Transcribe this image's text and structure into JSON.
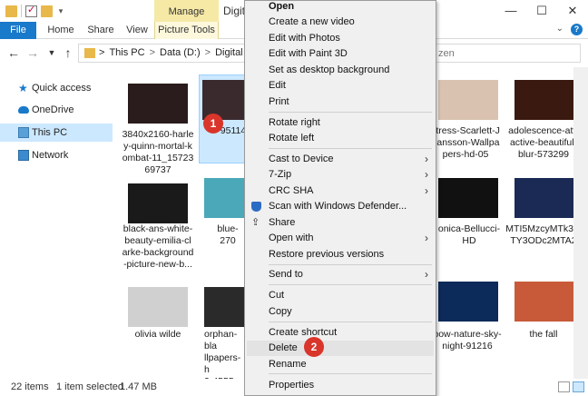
{
  "window": {
    "title": "Digit",
    "manage_tab": "Manage",
    "controls": {
      "minimize": "—",
      "maximize": "☐",
      "close": "✕"
    }
  },
  "ribbon": {
    "tabs": {
      "file": "File",
      "home": "Home",
      "share": "Share",
      "view": "View",
      "picture_tools": "Picture Tools"
    },
    "expand": "⌄",
    "help": "?"
  },
  "address_bar": {
    "crumbs": [
      "This PC",
      "Data (D:)",
      "Digital Citize"
    ],
    "separator": ">",
    "search_value": "zen"
  },
  "sidebar": {
    "items": [
      {
        "label": "Quick access",
        "icon": "star-icon"
      },
      {
        "label": "OneDrive",
        "icon": "cloud-icon"
      },
      {
        "label": "This PC",
        "icon": "computer-icon"
      },
      {
        "label": "Network",
        "icon": "network-icon"
      }
    ]
  },
  "files": [
    {
      "caption": [
        "3840x2160-harle",
        "y-quinn-mortal-k",
        "ombat-11_15723",
        "69737"
      ],
      "color": "#2a1c1c"
    },
    {
      "caption": [
        "95114"
      ],
      "color": "#3a2a2e"
    },
    {
      "caption": [
        "ctress-Scarlett-J",
        "hansson-Wallpa",
        "pers-hd-05"
      ],
      "color": "#d9c3b0"
    },
    {
      "caption": [
        "adolescence-attr",
        "active-beautiful-",
        "blur-573299"
      ],
      "color": "#3a1a10"
    },
    {
      "caption": [
        "black-ans-white-",
        "beauty-emilia-cl",
        "arke-background",
        "-picture-new-b..."
      ],
      "color": "#1a1a1a"
    },
    {
      "caption": [
        "blue-270"
      ],
      "color": "#4aa8b8"
    },
    {
      "caption": [
        "onica-Bellucci-",
        "HD"
      ],
      "color": "#111111"
    },
    {
      "caption": [
        "MTI5MzcyMTk3M",
        "TY3ODc2MTA2"
      ],
      "color": "#1b2a55"
    },
    {
      "caption": [
        "olivia wilde"
      ],
      "color": "#d0d0d0"
    },
    {
      "caption": [
        "orphan-bla",
        "llpapers-h",
        "3-4555"
      ],
      "color": "#2a2a2a"
    },
    {
      "caption": [
        "pow-nature-sky-",
        "night-91216"
      ],
      "color": "#0c2a5a"
    },
    {
      "caption": [
        "the fall"
      ],
      "color": "#c85a3a"
    }
  ],
  "status_bar": {
    "count": "22 items",
    "selected": "1 item selected",
    "size": "1.47 MB"
  },
  "context_menu": {
    "items": {
      "open": "Open",
      "create_video": "Create a new video",
      "edit_photos": "Edit with Photos",
      "edit_paint3d": "Edit with Paint 3D",
      "set_desktop_bg": "Set as desktop background",
      "edit": "Edit",
      "print": "Print",
      "rotate_right": "Rotate right",
      "rotate_left": "Rotate left",
      "cast_to_device": "Cast to Device",
      "seven_zip": "7-Zip",
      "crc_sha": "CRC SHA",
      "scan_defender": "Scan with Windows Defender...",
      "share": "Share",
      "open_with": "Open with",
      "restore_versions": "Restore previous versions",
      "send_to": "Send to",
      "cut": "Cut",
      "copy": "Copy",
      "create_shortcut": "Create shortcut",
      "delete": "Delete",
      "rename": "Rename",
      "properties": "Properties"
    },
    "submenu_arrow": "›"
  },
  "callouts": {
    "first": "1",
    "second": "2"
  },
  "colors": {
    "accent": "#1979ca",
    "selection": "#cce8ff",
    "callout": "#d9352b",
    "manage_tab": "#f6e9a6"
  }
}
